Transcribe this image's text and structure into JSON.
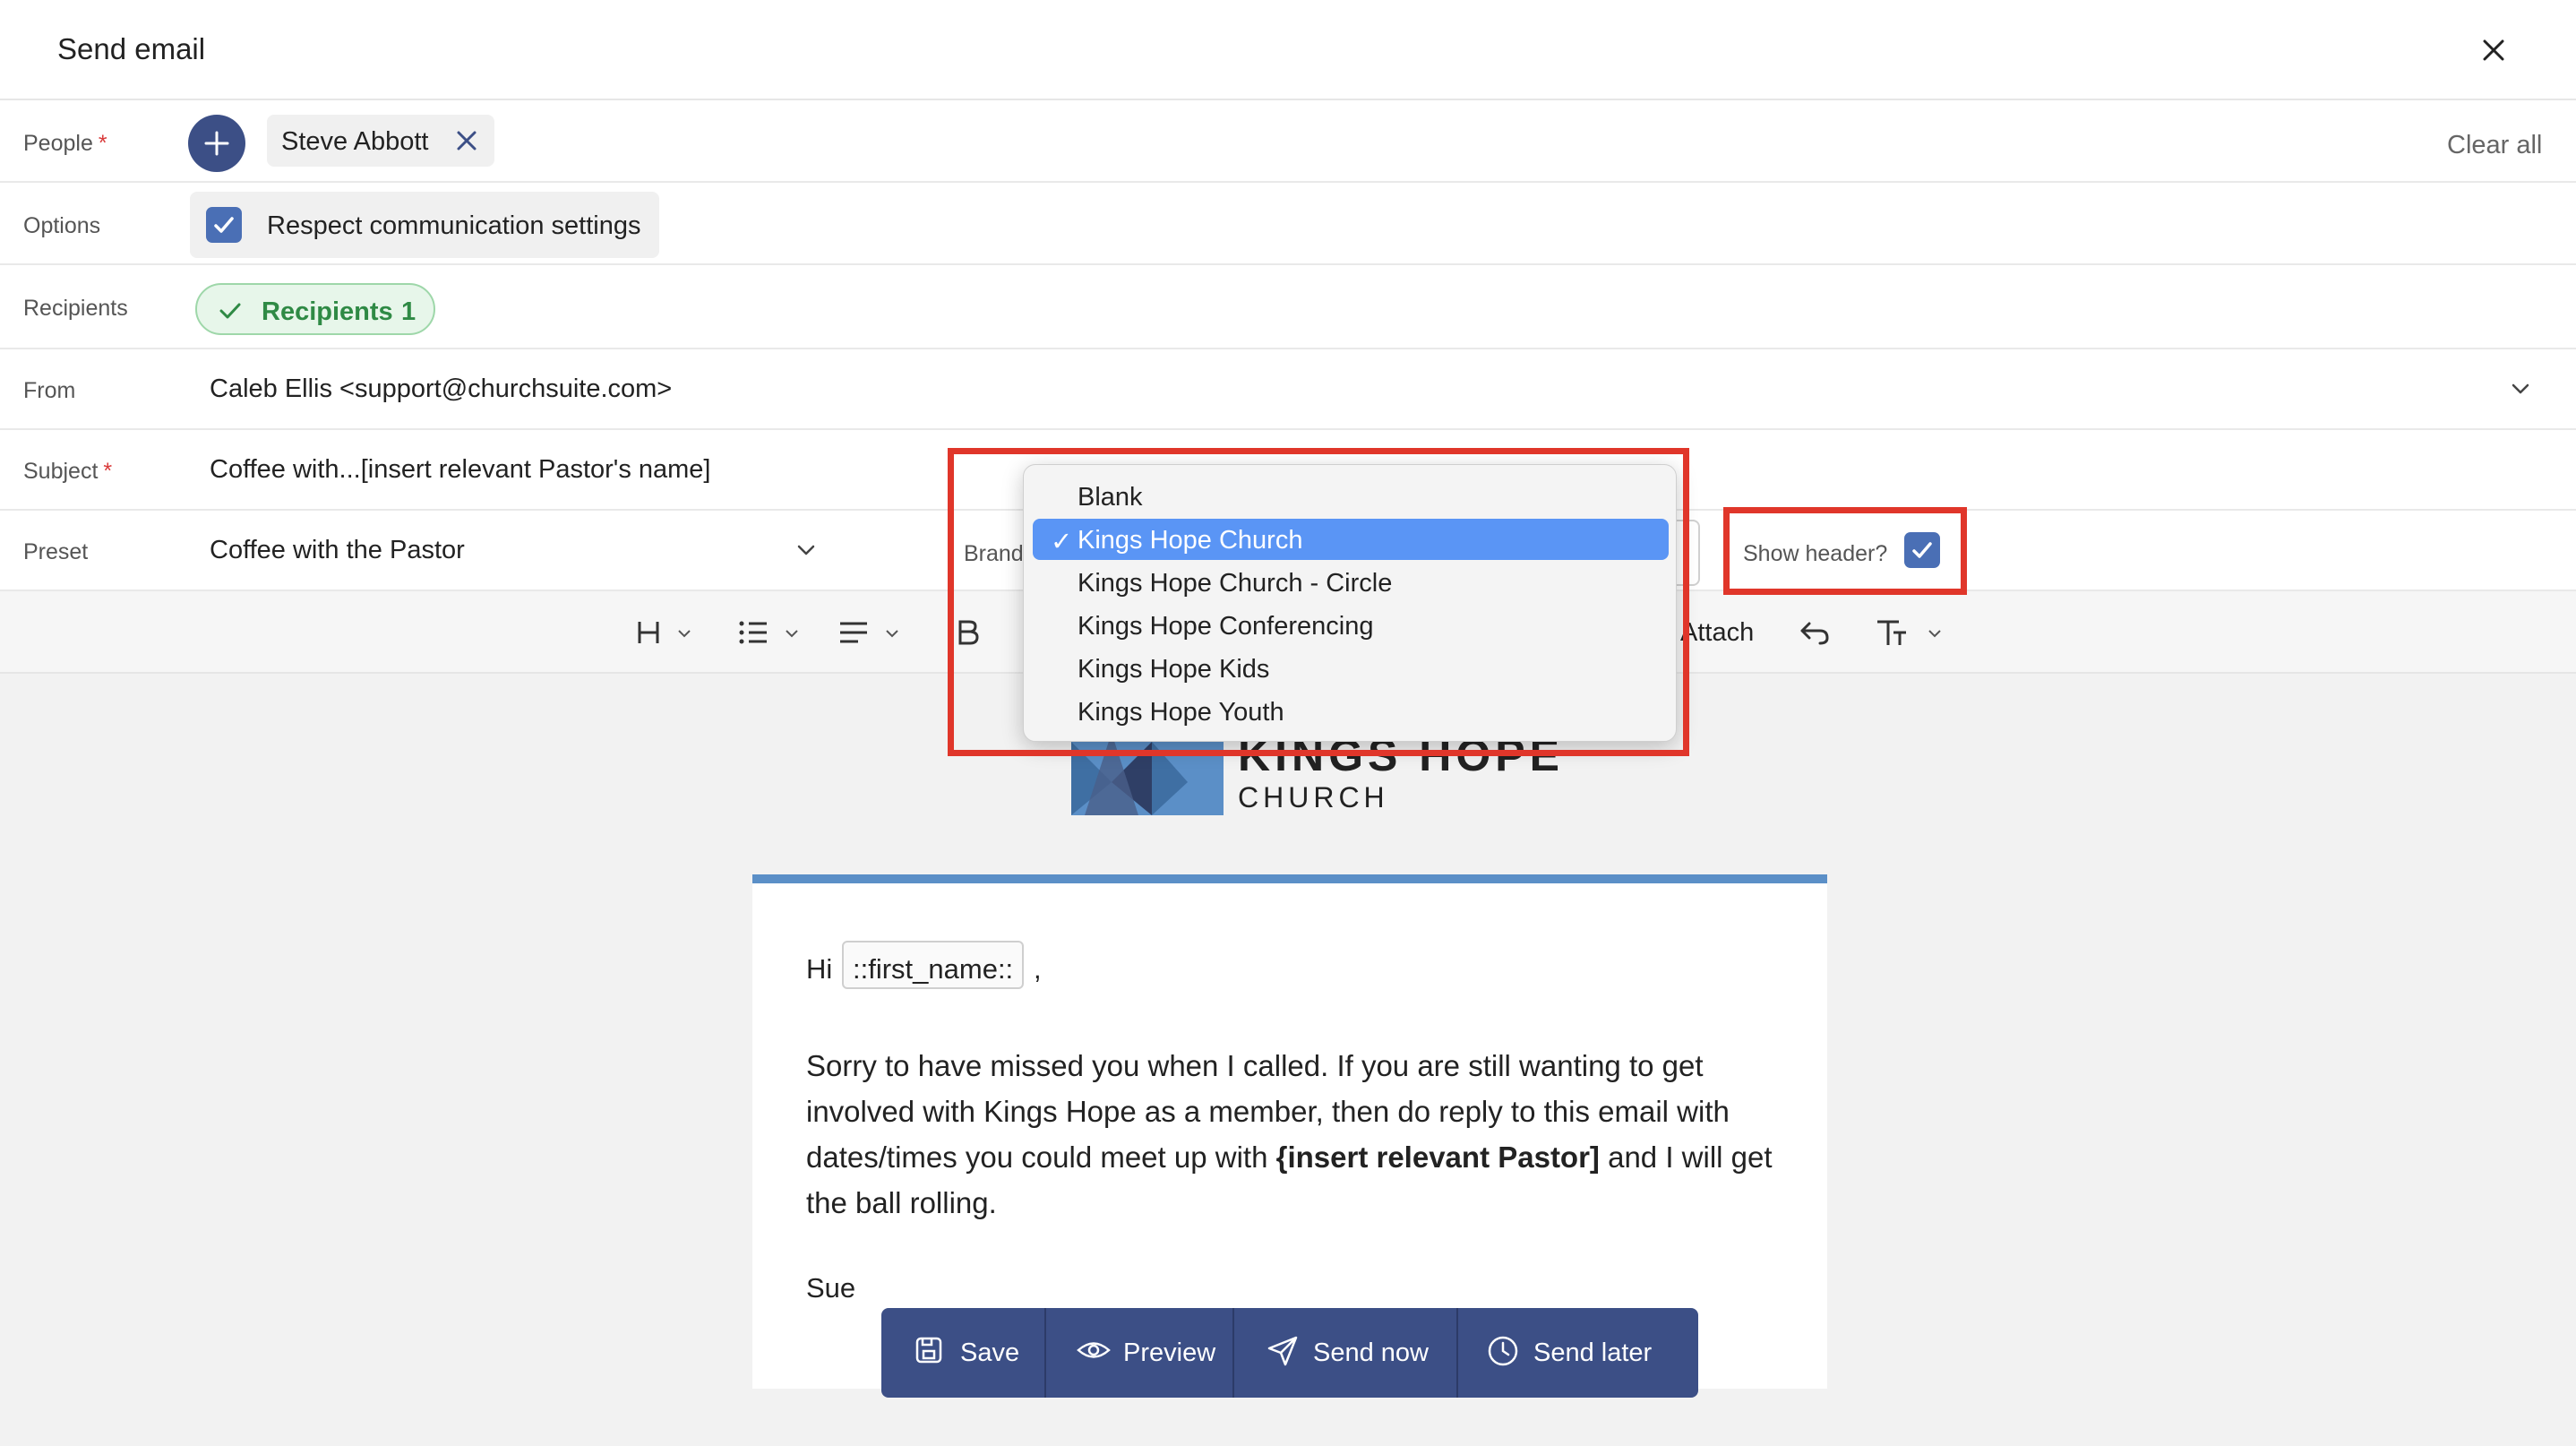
{
  "dialog": {
    "title": "Send email"
  },
  "people": {
    "label": "People",
    "required_mark": "*",
    "person_name": "Steve Abbott",
    "clear_all": "Clear all"
  },
  "options": {
    "label": "Options",
    "respect_settings": "Respect communication settings",
    "respect_checked": true
  },
  "recipients": {
    "label": "Recipients",
    "pill_label": "Recipients",
    "count": "1"
  },
  "from": {
    "label": "From",
    "value": "Caleb Ellis <support@churchsuite.com>"
  },
  "subject": {
    "label": "Subject",
    "required_mark": "*",
    "value": "Coffee with...[insert relevant Pastor's name]"
  },
  "preset": {
    "label": "Preset",
    "value": "Coffee with the Pastor",
    "brand_label": "Brand",
    "show_header_label": "Show header?",
    "show_header_checked": true
  },
  "brand_dropdown": {
    "options": [
      "Blank",
      "Kings Hope Church",
      "Kings Hope Church - Circle",
      "Kings Hope Conferencing",
      "Kings Hope Kids",
      "Kings Hope Youth"
    ],
    "selected": "Kings Hope Church",
    "tick": "✓"
  },
  "toolbar": {
    "attach_label": "Attach"
  },
  "email": {
    "logo_line1": "KINGS HOPE",
    "logo_line2": "CHURCH",
    "greeting": "Hi",
    "merge_tag": "::first_name::",
    "comma": ",",
    "para_before": "Sorry to have missed you when I called. If you are still wanting to get involved with Kings Hope as a member, then do reply to this email with dates/times you could meet up with ",
    "para_bold": "{insert relevant Pastor]",
    "para_after": " and I will get the ball rolling.",
    "signoff": "Sue"
  },
  "actions": {
    "save": "Save",
    "preview": "Preview",
    "send_now": "Send now",
    "send_later": "Send later"
  },
  "colors": {
    "accent": "#3c4f86",
    "checkbox": "#4a6fb5",
    "highlight": "#e0362a",
    "selected_option": "#5a95f5",
    "email_rule": "#5b8fc7"
  },
  "icons": [
    "close-icon",
    "plus-icon",
    "check-icon",
    "chevron-down-icon",
    "heading-icon",
    "list-icon",
    "align-icon",
    "bold-icon",
    "undo-icon",
    "text-size-icon",
    "save-icon",
    "eye-icon",
    "send-icon",
    "clock-icon"
  ]
}
